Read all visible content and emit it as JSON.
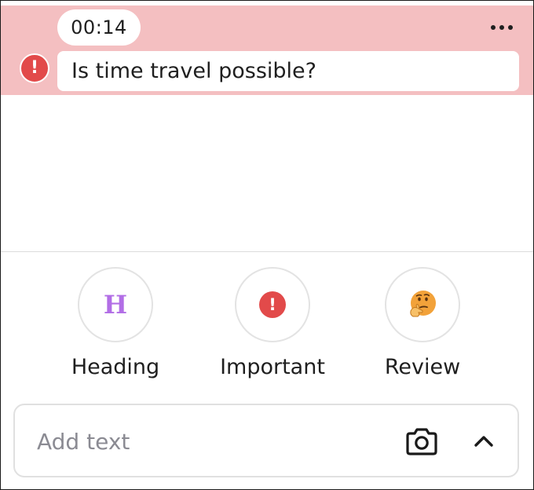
{
  "note": {
    "time": "00:14",
    "text": "Is time travel possible?",
    "more_icon": "more-horizontal-icon",
    "alert_icon": "exclamation-circle-icon",
    "band_color": "#f4bfc1"
  },
  "tags": [
    {
      "label": "Heading",
      "icon": "heading-h-icon",
      "glyph": "H",
      "color": "#b26ee6"
    },
    {
      "label": "Important",
      "icon": "exclamation-circle-icon",
      "color": "#e24a4a"
    },
    {
      "label": "Review",
      "icon": "thinking-face-icon",
      "color": "#f2a23a"
    }
  ],
  "composer": {
    "placeholder": "Add text",
    "camera_icon": "camera-icon",
    "expand_icon": "chevron-up-icon"
  }
}
